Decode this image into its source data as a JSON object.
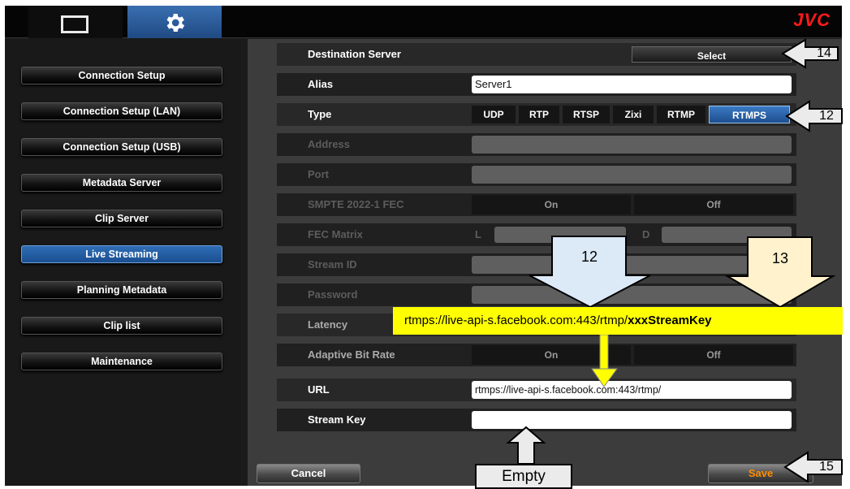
{
  "brand": "JVC",
  "tabs": [
    {
      "name": "display",
      "icon": "monitor-icon"
    },
    {
      "name": "settings",
      "icon": "gear-icon"
    }
  ],
  "sidebar": {
    "items": [
      {
        "label": "Connection Setup"
      },
      {
        "label": "Connection Setup (LAN)"
      },
      {
        "label": "Connection Setup (USB)"
      },
      {
        "label": "Metadata Server"
      },
      {
        "label": "Clip Server"
      },
      {
        "label": "Live Streaming",
        "active": true
      },
      {
        "label": "Planning Metadata"
      },
      {
        "label": "Clip list"
      },
      {
        "label": "Maintenance"
      }
    ]
  },
  "form": {
    "destination_label": "Destination Server",
    "select_label": "Select",
    "alias_label": "Alias",
    "alias_value": "Server1",
    "type_label": "Type",
    "type_options": [
      "UDP",
      "RTP",
      "RTSP",
      "Zixi",
      "RTMP",
      "RTMPS"
    ],
    "type_selected": "RTMPS",
    "address_label": "Address",
    "port_label": "Port",
    "smpte_label": "SMPTE 2022-1 FEC",
    "on_label": "On",
    "off_label": "Off",
    "fec_label": "FEC Matrix",
    "fec_l": "L",
    "fec_d": "D",
    "streamid_label": "Stream ID",
    "password_label": "Password",
    "latency_label": "Latency",
    "abr_label": "Adaptive Bit Rate",
    "url_label": "URL",
    "url_value": "rtmps://live-api-s.facebook.com:443/rtmp/",
    "streamkey_label": "Stream Key",
    "streamkey_value": ""
  },
  "buttons": {
    "cancel": "Cancel",
    "save": "Save"
  },
  "annotations": {
    "callout_14": "14",
    "callout_12_right": "12",
    "callout_12_top": "12",
    "callout_13": "13",
    "callout_15": "15",
    "empty_label": "Empty",
    "url_prefix": "rtmps://live-api-s.facebook.com:443/rtmp/",
    "url_key": "xxxStreamKey"
  },
  "colors": {
    "accent_blue": "#2f6db5",
    "brand_red": "#ff1a1a",
    "save_orange": "#ff8c00",
    "annotation_yellow": "#ffff00",
    "callout_blue": "#dce9f7",
    "callout_cream": "#fff2cc"
  }
}
